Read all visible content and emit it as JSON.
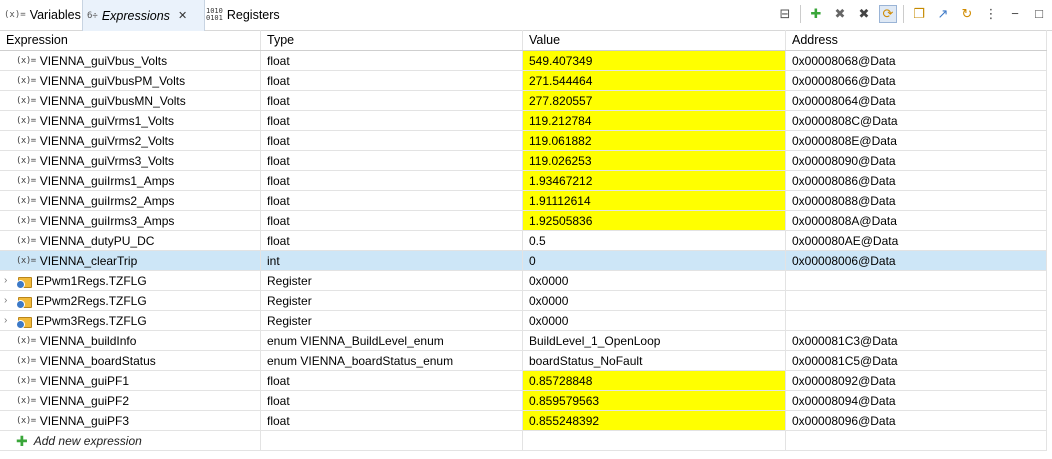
{
  "tabs": {
    "variables": {
      "icon": "(x)=",
      "label": "Variables"
    },
    "expressions": {
      "icon": "6÷",
      "label": "Expressions",
      "close": "✕"
    },
    "registers": {
      "icon": "1010\n0101",
      "label": "Registers"
    }
  },
  "toolbar": {
    "collapse": "⊟",
    "add": "✚",
    "remove": "✖",
    "remove_all": "✖",
    "refresh_auto": "⟳",
    "new_window": "❐",
    "export": "↗",
    "continuous_refresh": "↻",
    "menu": "⋮",
    "minimize": "−",
    "maximize": "□"
  },
  "columns": [
    "Expression",
    "Type",
    "Value",
    "Address"
  ],
  "rows": [
    {
      "name": "VIENNA_guiVbus_Volts",
      "type": "float",
      "value": "549.407349",
      "address": "0x00008068@Data"
    },
    {
      "name": "VIENNA_guiVbusPM_Volts",
      "type": "float",
      "value": "271.544464",
      "address": "0x00008066@Data"
    },
    {
      "name": "VIENNA_guiVbusMN_Volts",
      "type": "float",
      "value": "277.820557",
      "address": "0x00008064@Data"
    },
    {
      "name": "VIENNA_guiVrms1_Volts",
      "type": "float",
      "value": "119.212784",
      "address": "0x0000808C@Data"
    },
    {
      "name": "VIENNA_guiVrms2_Volts",
      "type": "float",
      "value": "119.061882",
      "address": "0x0000808E@Data"
    },
    {
      "name": "VIENNA_guiVrms3_Volts",
      "type": "float",
      "value": "119.026253",
      "address": "0x00008090@Data"
    },
    {
      "name": "VIENNA_guiIrms1_Amps",
      "type": "float",
      "value": "1.93467212",
      "address": "0x00008086@Data"
    },
    {
      "name": "VIENNA_guiIrms2_Amps",
      "type": "float",
      "value": "1.91112614",
      "address": "0x00008088@Data"
    },
    {
      "name": "VIENNA_guiIrms3_Amps",
      "type": "float",
      "value": "1.92505836",
      "address": "0x0000808A@Data"
    },
    {
      "name": "VIENNA_dutyPU_DC",
      "type": "float",
      "value": "0.5",
      "address": "0x000080AE@Data"
    },
    {
      "name": "VIENNA_clearTrip",
      "type": "int",
      "value": "0",
      "address": "0x00008006@Data"
    },
    {
      "name": "EPwm1Regs.TZFLG",
      "type": "Register",
      "value": "0x0000",
      "address": ""
    },
    {
      "name": "EPwm2Regs.TZFLG",
      "type": "Register",
      "value": "0x0000",
      "address": ""
    },
    {
      "name": "EPwm3Regs.TZFLG",
      "type": "Register",
      "value": "0x0000",
      "address": ""
    },
    {
      "name": "VIENNA_buildInfo",
      "type": "enum VIENNA_BuildLevel_enum",
      "value": "BuildLevel_1_OpenLoop",
      "address": "0x000081C3@Data"
    },
    {
      "name": "VIENNA_boardStatus",
      "type": "enum VIENNA_boardStatus_enum",
      "value": "boardStatus_NoFault",
      "address": "0x000081C5@Data"
    },
    {
      "name": "VIENNA_guiPF1",
      "type": "float",
      "value": "0.85728848",
      "address": "0x00008092@Data"
    },
    {
      "name": "VIENNA_guiPF2",
      "type": "float",
      "value": "0.859579563",
      "address": "0x00008094@Data"
    },
    {
      "name": "VIENNA_guiPF3",
      "type": "float",
      "value": "0.855248392",
      "address": "0x00008096@Data"
    }
  ],
  "var_icon": "(x)=",
  "add_new": {
    "icon": "✚",
    "label": "Add new expression"
  },
  "colors": {
    "changed_value": "#ffff00",
    "selected_row": "#cde6f7",
    "add_icon": "#3aa63a"
  }
}
